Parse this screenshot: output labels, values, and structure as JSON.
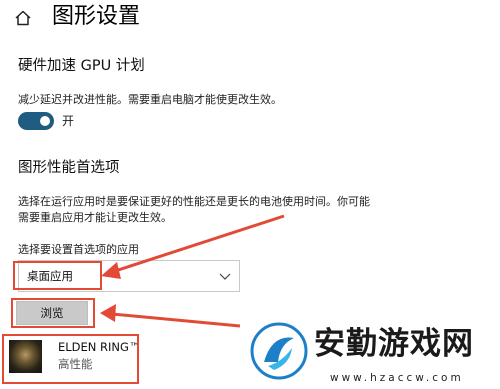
{
  "header": {
    "title": "图形设置",
    "home_icon": "home-icon"
  },
  "gpu_scheduling": {
    "heading": "硬件加速 GPU 计划",
    "description": "减少延迟并改进性能。需要重启电脑才能使更改生效。",
    "toggle_state": "on",
    "toggle_label": "开"
  },
  "performance_prefs": {
    "heading": "图形性能首选项",
    "description_line1": "选择在运行应用时是要保证更好的性能还是更长的电池使用时间。你可能",
    "description_line2": "需要重启应用才能让更改生效。",
    "select_label": "选择要设置首选项的应用",
    "select_value": "桌面应用",
    "browse_label": "浏览"
  },
  "app_entry": {
    "name": "ELDEN RING™",
    "preference": "高性能"
  },
  "colors": {
    "accent": "#1f5c82",
    "highlight": "#e34a36",
    "button": "#c9c9c9"
  },
  "watermark": {
    "brand": "安勤游戏网",
    "url": "www.hzaccw.com"
  }
}
